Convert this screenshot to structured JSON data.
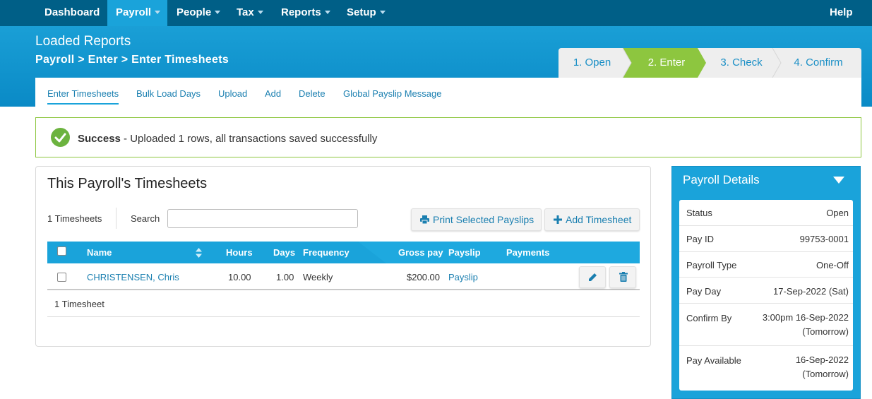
{
  "topnav": {
    "items": [
      {
        "label": "Dashboard"
      },
      {
        "label": "Payroll"
      },
      {
        "label": "People"
      },
      {
        "label": "Tax"
      },
      {
        "label": "Reports"
      },
      {
        "label": "Setup"
      }
    ],
    "help": "Help",
    "active_color": "#1aa3da",
    "bar_color": "#005f87"
  },
  "header": {
    "title": "Loaded Reports",
    "breadcrumb": "Payroll > Enter > Enter Timesheets"
  },
  "steps": [
    {
      "label": "1. Open",
      "active": false
    },
    {
      "label": "2. Enter",
      "active": true
    },
    {
      "label": "3. Check",
      "active": false
    },
    {
      "label": "4. Confirm",
      "active": false
    }
  ],
  "steps_active_color": "#8dc63f",
  "subnav": {
    "tabs": [
      {
        "label": "Enter Timesheets",
        "active": true
      },
      {
        "label": "Bulk Load Days"
      },
      {
        "label": "Upload"
      },
      {
        "label": "Add"
      },
      {
        "label": "Delete"
      },
      {
        "label": "Global Payslip Message"
      }
    ]
  },
  "alert": {
    "strong": "Success",
    "message": " - Uploaded 1 rows, all transactions saved successfully",
    "icon": "check-circle-icon",
    "color": "#6cb33f"
  },
  "timesheets": {
    "title": "This Payroll's Timesheets",
    "count_label": "1 Timesheets",
    "search_label": "Search",
    "search_value": "",
    "print_button": "Print Selected Payslips",
    "add_button": "Add Timesheet",
    "columns": [
      "Name",
      "Hours",
      "Days",
      "Frequency",
      "Gross pay",
      "Payslip",
      "Payments"
    ],
    "rows": [
      {
        "name": "CHRISTENSEN, Chris",
        "hours": "10.00",
        "days": "1.00",
        "frequency": "Weekly",
        "gross_pay": "$200.00",
        "payslip": "Payslip",
        "payments": ""
      }
    ],
    "footer": "1 Timesheet"
  },
  "details": {
    "title": "Payroll Details",
    "rows": [
      {
        "label": "Status",
        "value": "Open",
        "value2": ""
      },
      {
        "label": "Pay ID",
        "value": "99753-0001",
        "value2": ""
      },
      {
        "label": "Payroll Type",
        "value": "One-Off",
        "value2": ""
      },
      {
        "label": "Pay Day",
        "value": "17-Sep-2022 (Sat)",
        "value2": ""
      },
      {
        "label": "Confirm By",
        "value": "3:00pm 16-Sep-2022",
        "value2": "(Tomorrow)"
      },
      {
        "label": "Pay Available",
        "value": "16-Sep-2022",
        "value2": "(Tomorrow)"
      }
    ]
  }
}
